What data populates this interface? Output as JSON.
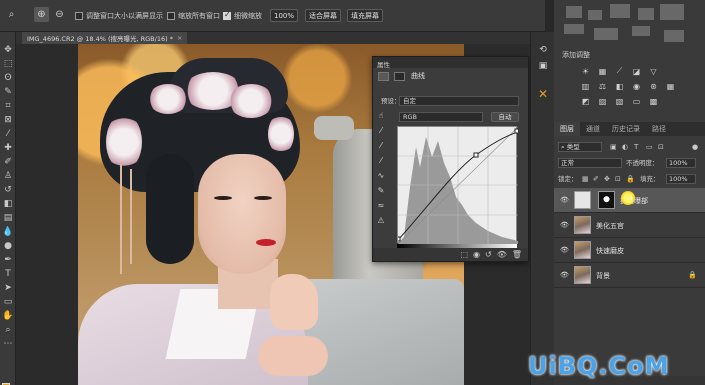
{
  "options_bar": {
    "resize_windows_label": "调整窗口大小以满屏显示",
    "zoom_all_windows_label": "缩放所有窗口",
    "scrubby_zoom_label": "细微缩放",
    "zoom_value": "100%",
    "fit_screen_label": "适合屏幕",
    "fill_screen_label": "填充屏幕"
  },
  "document_tab": {
    "title": "IMG_4696.CR2 @ 18.4% (搜亮曝光, RGB/16) *",
    "close": "×"
  },
  "properties_panel": {
    "title": "属性",
    "adjustment_name": "曲线",
    "preset_label": "预设：",
    "preset_value": "自定",
    "channel_value": "RGB",
    "auto_button": "自动"
  },
  "adjustments_panel": {
    "title": "添加调整"
  },
  "layers_panel": {
    "tabs": [
      {
        "label": "图层",
        "active": true
      },
      {
        "label": "通道",
        "active": false
      },
      {
        "label": "历史记录",
        "active": false
      },
      {
        "label": "路径",
        "active": false
      }
    ],
    "filter_value": "类型",
    "blend_mode": "正常",
    "opacity_label": "不透明度：",
    "opacity_value": "100%",
    "lock_label": "锁定：",
    "fill_label": "填充：",
    "fill_value": "100%",
    "layers": [
      {
        "name": "提亮曝部",
        "type": "adjustment",
        "selected": true,
        "locked": false
      },
      {
        "name": "美化五官",
        "type": "pixel",
        "selected": false,
        "locked": false
      },
      {
        "name": "快速磨皮",
        "type": "pixel",
        "selected": false,
        "locked": false
      },
      {
        "name": "背景",
        "type": "pixel",
        "selected": false,
        "locked": true
      }
    ]
  },
  "watermark": "UiBQ.CoM",
  "colors": {
    "foreground": "#e4a11b",
    "background": "#ffffff",
    "accent_yellow": "#f2cf1a",
    "watermark_blue": "#4aa3e8"
  }
}
